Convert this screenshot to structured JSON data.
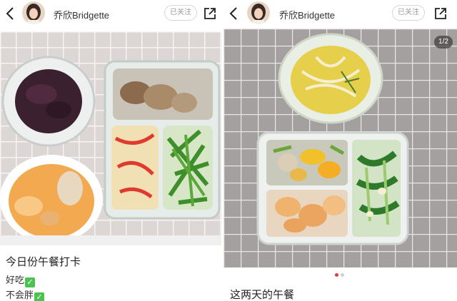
{
  "left_post": {
    "username": "乔欣Bridgette",
    "follow_label": "已关注",
    "caption_title": "今日份午餐打卡",
    "caption_lines": [
      "好吃",
      "不会胖"
    ],
    "check_glyph": "✓"
  },
  "right_post": {
    "username": "乔欣Bridgette",
    "follow_label": "已关注",
    "image_counter": "1/2",
    "caption_title": "这两天的午餐"
  },
  "icons": [
    "back-arrow-icon",
    "share-icon",
    "check-mark-icon"
  ],
  "colors": {
    "check_green": "#4cc250",
    "active_dot": "#e8383d",
    "inactive_dot": "#cfcfcf",
    "counter_bg": "#3c3c3c"
  }
}
